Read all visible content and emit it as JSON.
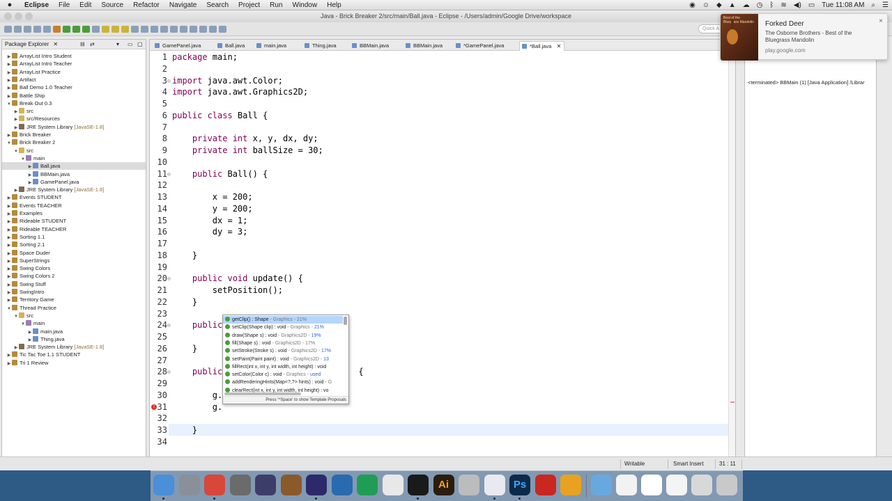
{
  "menubar": {
    "apple": "",
    "items": [
      "Eclipse",
      "File",
      "Edit",
      "Source",
      "Refactor",
      "Navigate",
      "Search",
      "Project",
      "Run",
      "Window",
      "Help"
    ],
    "clock": "Tue 11:08 AM"
  },
  "window": {
    "title": "Java - Brick Breaker 2/src/main/Ball.java - Eclipse - /Users/admin/Google Drive/workspace",
    "quick_access": "Quick A"
  },
  "package_explorer": {
    "title": "Package Explorer",
    "items": [
      {
        "label": "ArrayList Intro Student",
        "depth": 0,
        "icon": "proj",
        "twisty": "▶"
      },
      {
        "label": "ArrayList Intro Teacher",
        "depth": 0,
        "icon": "proj",
        "twisty": "▶"
      },
      {
        "label": "ArrayList Practice",
        "depth": 0,
        "icon": "proj",
        "twisty": "▶"
      },
      {
        "label": "Artifact",
        "depth": 0,
        "icon": "proj",
        "twisty": "▶"
      },
      {
        "label": "Ball Demo 1.0 Teacher",
        "depth": 0,
        "icon": "proj",
        "twisty": "▶"
      },
      {
        "label": "Battle Ship",
        "depth": 0,
        "icon": "proj",
        "twisty": "▶"
      },
      {
        "label": "Break Out 0.3",
        "depth": 0,
        "icon": "proj",
        "twisty": "▼"
      },
      {
        "label": "src",
        "depth": 1,
        "icon": "folder",
        "twisty": "▶"
      },
      {
        "label": "src/Resources",
        "depth": 1,
        "icon": "folder",
        "twisty": "▶"
      },
      {
        "label": "JRE System Library",
        "suffix": "[JavaSE-1.8]",
        "depth": 1,
        "icon": "lib",
        "twisty": "▶"
      },
      {
        "label": "Brick Breaker",
        "depth": 0,
        "icon": "proj",
        "twisty": "▶"
      },
      {
        "label": "Brick Breaker 2",
        "depth": 0,
        "icon": "proj",
        "twisty": "▼"
      },
      {
        "label": "src",
        "depth": 1,
        "icon": "folder",
        "twisty": "▼"
      },
      {
        "label": "main",
        "depth": 2,
        "icon": "pkgi",
        "twisty": "▼"
      },
      {
        "label": "Ball.java",
        "depth": 3,
        "icon": "java",
        "twisty": "▶",
        "selected": true
      },
      {
        "label": "BBMain.java",
        "depth": 3,
        "icon": "java",
        "twisty": "▶"
      },
      {
        "label": "GamePanel.java",
        "depth": 3,
        "icon": "java",
        "twisty": "▶"
      },
      {
        "label": "JRE System Library",
        "suffix": "[JavaSE-1.8]",
        "depth": 1,
        "icon": "lib",
        "twisty": "▶"
      },
      {
        "label": "Events STUDENT",
        "depth": 0,
        "icon": "proj",
        "twisty": "▶"
      },
      {
        "label": "Events TEACHER",
        "depth": 0,
        "icon": "proj",
        "twisty": "▶"
      },
      {
        "label": "Examples",
        "depth": 0,
        "icon": "proj",
        "twisty": "▶"
      },
      {
        "label": "Rideable STUDENT",
        "depth": 0,
        "icon": "proj",
        "twisty": "▶"
      },
      {
        "label": "Rideable TEACHER",
        "depth": 0,
        "icon": "proj",
        "twisty": "▶"
      },
      {
        "label": "Sorting 1.1",
        "depth": 0,
        "icon": "proj",
        "twisty": "▶"
      },
      {
        "label": "Sorting 2.1",
        "depth": 0,
        "icon": "proj",
        "twisty": "▶"
      },
      {
        "label": "Space Duder",
        "depth": 0,
        "icon": "proj",
        "twisty": "▶"
      },
      {
        "label": "SuperStrings",
        "depth": 0,
        "icon": "proj",
        "twisty": "▶"
      },
      {
        "label": "Swing Colors",
        "depth": 0,
        "icon": "proj",
        "twisty": "▶"
      },
      {
        "label": "Swing Colors 2",
        "depth": 0,
        "icon": "proj",
        "twisty": "▶"
      },
      {
        "label": "Swing Stuff",
        "depth": 0,
        "icon": "proj",
        "twisty": "▶"
      },
      {
        "label": "SwingIntro",
        "depth": 0,
        "icon": "proj",
        "twisty": "▶"
      },
      {
        "label": "Territory Game",
        "depth": 0,
        "icon": "proj",
        "twisty": "▶"
      },
      {
        "label": "Thread Practice",
        "depth": 0,
        "icon": "proj",
        "twisty": "▼"
      },
      {
        "label": "src",
        "depth": 1,
        "icon": "folder",
        "twisty": "▼"
      },
      {
        "label": "main",
        "depth": 2,
        "icon": "pkgi",
        "twisty": "▼"
      },
      {
        "label": "main.java",
        "depth": 3,
        "icon": "java",
        "twisty": "▶"
      },
      {
        "label": "Thing.java",
        "depth": 3,
        "icon": "java",
        "twisty": "▶"
      },
      {
        "label": "JRE System Library",
        "suffix": "[JavaSE-1.8]",
        "depth": 1,
        "icon": "lib",
        "twisty": "▶"
      },
      {
        "label": "Tic Tac Toe 1.1 STUDENT",
        "depth": 0,
        "icon": "proj",
        "twisty": "▶"
      },
      {
        "label": "Tri 1 Review",
        "depth": 0,
        "icon": "proj",
        "twisty": "▶"
      }
    ]
  },
  "editor": {
    "tabs": [
      "GamePanel.java",
      "Ball.java",
      "main.java",
      "Thing.java",
      "BBMain.java",
      "BBMain.java",
      "*GamePanel.java",
      "*Ball.java"
    ],
    "active_tab_index": 7,
    "close_glyph": "✕",
    "lines": [
      {
        "n": "1",
        "code": [
          [
            "kw",
            "package"
          ],
          [
            "",
            "main;"
          ]
        ]
      },
      {
        "n": "2",
        "code": []
      },
      {
        "n": "3",
        "code": [
          [
            "kw",
            "import"
          ],
          [
            "",
            "java.awt.Color;"
          ]
        ]
      },
      {
        "n": "4",
        "code": [
          [
            "kw",
            "import"
          ],
          [
            "",
            "java.awt.Graphics2D;"
          ]
        ]
      },
      {
        "n": "5",
        "code": []
      },
      {
        "n": "6",
        "code": [
          [
            "kw",
            "public class"
          ],
          [
            "",
            "Ball {"
          ]
        ]
      },
      {
        "n": "7",
        "code": []
      },
      {
        "n": "8",
        "code": [
          [
            "",
            "    "
          ],
          [
            "kw",
            "private int"
          ],
          [
            "",
            "x, y, dx, dy;"
          ]
        ]
      },
      {
        "n": "9",
        "code": [
          [
            "",
            "    "
          ],
          [
            "kw",
            "private int"
          ],
          [
            "",
            "ballSize = 30;"
          ]
        ]
      },
      {
        "n": "10",
        "code": []
      },
      {
        "n": "11",
        "code": [
          [
            "",
            "    "
          ],
          [
            "kw",
            "public"
          ],
          [
            "",
            "Ball() {"
          ]
        ]
      },
      {
        "n": "12",
        "code": []
      },
      {
        "n": "13",
        "code": [
          [
            "",
            "        x = 200;"
          ]
        ]
      },
      {
        "n": "14",
        "code": [
          [
            "",
            "        y = 200;"
          ]
        ]
      },
      {
        "n": "15",
        "code": [
          [
            "",
            "        dx = 1;"
          ]
        ]
      },
      {
        "n": "16",
        "code": [
          [
            "",
            "        dy = 3;"
          ]
        ]
      },
      {
        "n": "17",
        "code": []
      },
      {
        "n": "18",
        "code": [
          [
            "",
            "    }"
          ]
        ]
      },
      {
        "n": "19",
        "code": []
      },
      {
        "n": "20",
        "code": [
          [
            "",
            "    "
          ],
          [
            "kw",
            "public void"
          ],
          [
            "",
            "update() {"
          ]
        ]
      },
      {
        "n": "21",
        "code": [
          [
            "",
            "        setPosition();"
          ]
        ]
      },
      {
        "n": "22",
        "code": [
          [
            "",
            "    }"
          ]
        ]
      },
      {
        "n": "23",
        "code": []
      },
      {
        "n": "24",
        "code": [
          [
            "",
            "    "
          ],
          [
            "kw",
            "public"
          ]
        ]
      },
      {
        "n": "25",
        "code": []
      },
      {
        "n": "26",
        "code": [
          [
            "",
            "    }"
          ]
        ]
      },
      {
        "n": "27",
        "code": []
      },
      {
        "n": "28",
        "code": [
          [
            "",
            "    "
          ],
          [
            "kw",
            "public"
          ],
          [
            "",
            "                          {"
          ]
        ]
      },
      {
        "n": "29",
        "code": []
      },
      {
        "n": "30",
        "code": [
          [
            "",
            "        g."
          ],
          [
            "",
            "                      ;"
          ]
        ]
      },
      {
        "n": "31",
        "code": [
          [
            "",
            "        g."
          ]
        ]
      },
      {
        "n": "32",
        "code": []
      },
      {
        "n": "33",
        "code": [
          [
            "",
            "    }"
          ]
        ]
      },
      {
        "n": "34",
        "code": []
      }
    ]
  },
  "autocomplete": {
    "items": [
      {
        "sig": "getClip() : Shape",
        "type": " - Graphics - 21%",
        "selected": true
      },
      {
        "sig": "setClip(Shape clip) : void",
        "type": " - Graphics - ",
        "pct": "21%"
      },
      {
        "sig": "draw(Shape s) : void",
        "type": " - Graphics2D - ",
        "pct": "19%"
      },
      {
        "sig": "fill(Shape s) : void",
        "type": " - Graphics2D - 17%"
      },
      {
        "sig": "setStroke(Stroke s) : void",
        "type": " - Graphics2D - ",
        "pct": "17%"
      },
      {
        "sig": "setPaint(Paint paint) : void",
        "type": " - Graphics2D - ",
        "pct": "13"
      },
      {
        "sig": "fillRect(int x, int y, int width, int height) : void",
        "type": ""
      },
      {
        "sig": "setColor(Color c) : void",
        "type": " - Graphics - ",
        "pct": "used"
      },
      {
        "sig": "addRenderingHints(Map<?,?> hints) : void",
        "type": " - G"
      },
      {
        "sig": "clearRect(int x, int y, int width, int height) : vo",
        "type": ""
      }
    ],
    "hint": "Press '^Space' to show Template Proposals"
  },
  "console": {
    "text": "<terminated> BBMain (1) [Java Application] /Librar"
  },
  "status": {
    "writable": "Writable",
    "insert_mode": "Smart Insert",
    "position": "31 : 11"
  },
  "notification": {
    "title": "Forked Deer",
    "subtitle": "The Osborne Brothers - Best of the Bluegrass Mandolin",
    "source": "play.google.com",
    "close": "×",
    "art_text": "Best of the Bluegrass Mandolin"
  },
  "dock": {
    "apps": [
      {
        "name": "finder-icon",
        "color": "#4a8fd8"
      },
      {
        "name": "launchpad-icon",
        "color": "#8a8f99"
      },
      {
        "name": "chrome-icon",
        "color": "#d9463a"
      },
      {
        "name": "calculator-icon",
        "color": "#6b6b6b"
      },
      {
        "name": "imovie-star-icon",
        "color": "#3d3d6a"
      },
      {
        "name": "guitar-icon",
        "color": "#8a5a2a"
      },
      {
        "name": "eclipse-icon",
        "color": "#2c2a6a"
      },
      {
        "name": "quicktime-icon",
        "color": "#2a6ab0"
      },
      {
        "name": "hangouts-icon",
        "color": "#1f9d55"
      },
      {
        "name": "app-grid-icon",
        "color": "#e8e8e8"
      },
      {
        "name": "activity-monitor-icon",
        "color": "#1a1a1a"
      },
      {
        "name": "illustrator-icon",
        "color": "#2b1d0e"
      },
      {
        "name": "utilities-icon",
        "color": "#bcbcbc"
      },
      {
        "name": "textedit-icon",
        "color": "#e9e9f0"
      },
      {
        "name": "photoshop-icon",
        "color": "#0d2a4a"
      },
      {
        "name": "acrobat-icon",
        "color": "#c9271f"
      },
      {
        "name": "outlook-icon",
        "color": "#e8a21f"
      },
      {
        "name": "applications-folder-icon",
        "color": "#68a8e0"
      },
      {
        "name": "document-csv-icon",
        "color": "#f2f2f2"
      },
      {
        "name": "document-icon",
        "color": "#ffffff"
      },
      {
        "name": "document-blank-icon",
        "color": "#f4f4f4"
      },
      {
        "name": "screenshot-icon",
        "color": "#d8d8d8"
      },
      {
        "name": "trash-icon",
        "color": "#c9c9c9"
      }
    ],
    "ai_label": "Ai",
    "ps_label": "Ps"
  }
}
